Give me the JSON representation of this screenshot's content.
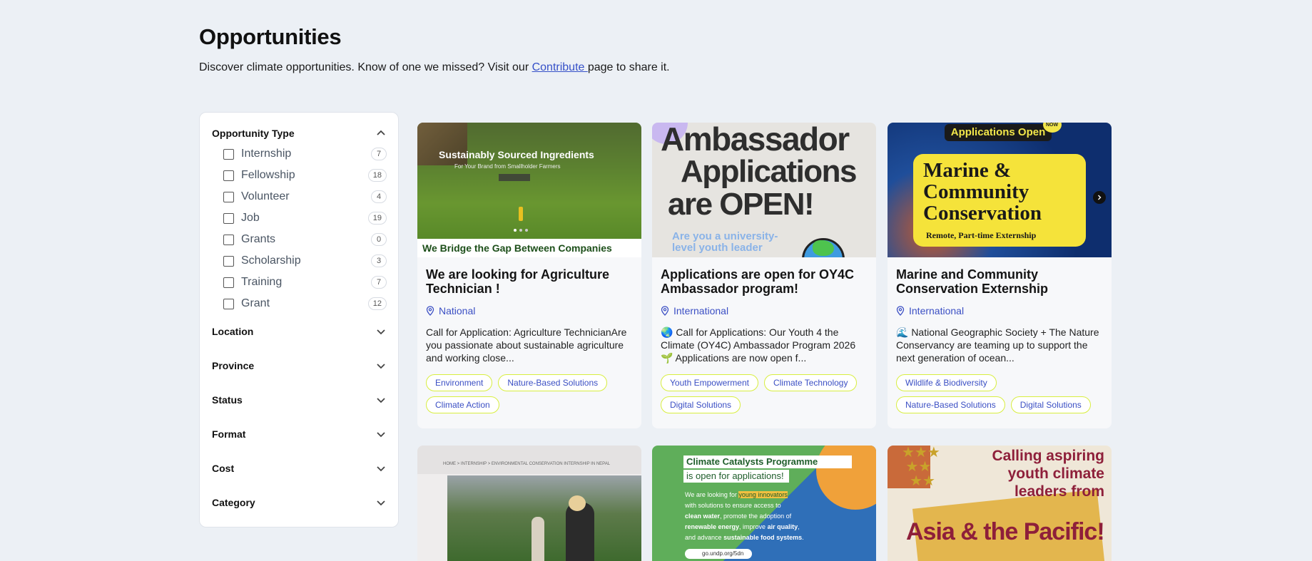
{
  "header": {
    "title": "Opportunities",
    "subtitle_before": "Discover climate opportunities. Know of one we missed? Visit our ",
    "contribute_link": "Contribute ",
    "subtitle_after": "page to share it."
  },
  "filters": {
    "opportunity_type": {
      "label": "Opportunity Type",
      "options": [
        {
          "label": "Internship",
          "count": "7"
        },
        {
          "label": "Fellowship",
          "count": "18"
        },
        {
          "label": "Volunteer",
          "count": "4"
        },
        {
          "label": "Job",
          "count": "19"
        },
        {
          "label": "Grants",
          "count": "0"
        },
        {
          "label": "Scholarship",
          "count": "3"
        },
        {
          "label": "Training",
          "count": "7"
        },
        {
          "label": "Grant",
          "count": "12"
        }
      ]
    },
    "collapsed": [
      "Location",
      "Province",
      "Status",
      "Format",
      "Cost",
      "Category"
    ]
  },
  "cards": [
    {
      "title": "We are looking for Agriculture Technician !",
      "location": "National",
      "description": "Call for Application: Agriculture TechnicianAre you passionate about sustainable agriculture and working close...",
      "tags": [
        "Environment",
        "Nature-Based Solutions",
        "Climate Action"
      ],
      "image_text": {
        "headline": "Sustainably Sourced Ingredients",
        "small": "For Your Brand from Smallholder Farmers",
        "banner": "We Bridge the Gap Between Companies"
      }
    },
    {
      "title": "Applications are open for OY4C Ambassador program!",
      "location": "International",
      "description": "🌏 Call for Applications: Our Youth 4 the Climate (OY4C) Ambassador Program 2026 🌱 Applications are now open f...",
      "tags": [
        "Youth Empowerment",
        "Climate Technology",
        "Digital Solutions"
      ],
      "image_text": {
        "line1": "Ambassador",
        "line2": "Applications",
        "line3": "are OPEN!",
        "sub": "Are you a university-level youth leader"
      }
    },
    {
      "title": "Marine and Community Conservation Externship",
      "location": "International",
      "description": "🌊 National Geographic Society + The Nature Conservancy are teaming up to support the next generation of ocean...",
      "tags": [
        "Wildlife & Biodiversity",
        "Nature-Based Solutions",
        "Digital Solutions"
      ],
      "image_text": {
        "badge": "Applications Open",
        "now": "NOW",
        "line1": "Marine &",
        "line2": "Community",
        "line3": "Conservation",
        "sub": "Remote, Part-time Externship"
      }
    },
    {
      "image_text": {
        "crumb": "HOME > INTERNSHIP > ENVIRONMENTAL CONSERVATION INTERNSHIP IN NEPAL"
      }
    },
    {
      "image_text": {
        "l1": "Climate Catalysts Programme",
        "l2": "is open for applications!",
        "b1": "We are looking for",
        "b1h": "young innovators",
        "b2": "with solutions to ensure access to",
        "b3": "clean water",
        "b3b": ", promote the adoption of",
        "b4": "renewable energy",
        "b4b": ", improve",
        "b4c": "air quality",
        "b4d": ",",
        "b5": "and advance",
        "b5b": "sustainable food systems",
        "b5c": ".",
        "url": "go.undp.org/5dn"
      }
    },
    {
      "image_text": {
        "l1": "Calling aspiring",
        "l2": "youth climate",
        "l3": "leaders from",
        "l4": "Asia & the Pacific!"
      }
    }
  ]
}
